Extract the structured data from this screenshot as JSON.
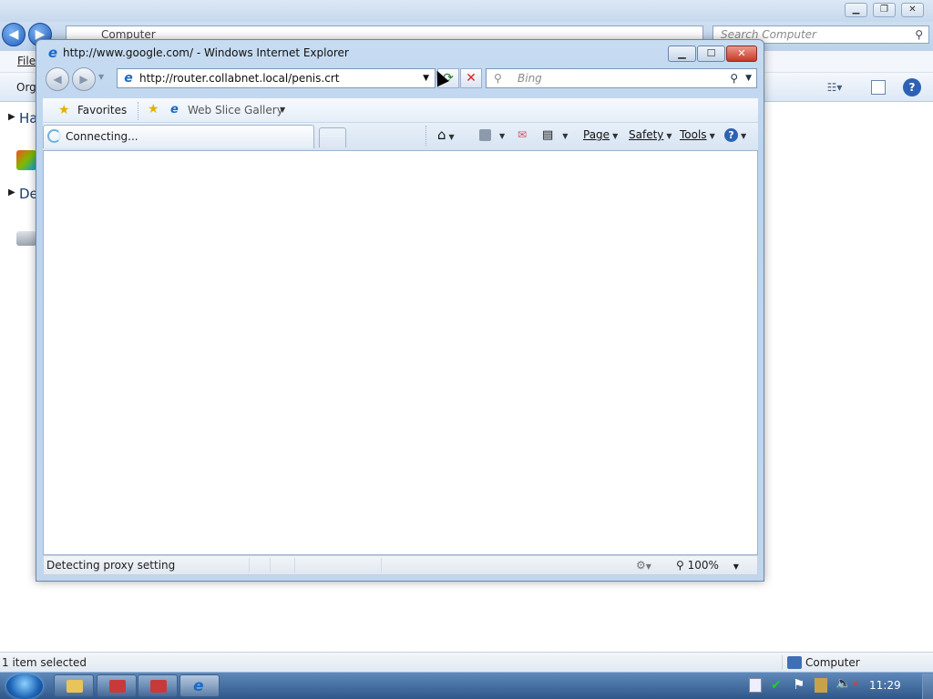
{
  "explorer": {
    "address": "Computer",
    "search_placeholder": "Search Computer",
    "menu_file": "File",
    "cmd_organize": "Org",
    "side_items": [
      "Ha",
      "De"
    ],
    "status_left": "1 item selected",
    "status_right": "Computer"
  },
  "ie": {
    "title": "http://www.google.com/ - Windows Internet Explorer",
    "address": "http://router.collabnet.local/penis.crt",
    "search_placeholder": "Bing",
    "favorites_label": "Favorites",
    "web_slice_label": "Web Slice Gallery",
    "tab_label": "Connecting...",
    "cmd_page": "Page",
    "cmd_safety": "Safety",
    "cmd_tools": "Tools",
    "status_text": "Detecting proxy setting",
    "zoom": "100%"
  },
  "taskbar": {
    "clock": "11:29"
  },
  "colors": {
    "title_bar": "#c7dcf1",
    "taskbar": "#2f5789",
    "close_button": "#c6382a"
  },
  "icons": [
    "back-icon",
    "forward-icon",
    "ie-logo-icon",
    "refresh-icon",
    "stop-icon",
    "search-icon",
    "favorites-star-icon",
    "add-favorite-icon",
    "home-icon",
    "feeds-icon",
    "mail-icon",
    "print-icon",
    "help-icon",
    "loading-spinner-icon",
    "zoom-icon",
    "security-icon",
    "start-orb-icon",
    "folder-icon",
    "flag-icon",
    "volume-muted-icon",
    "network-icon",
    "computer-icon"
  ]
}
